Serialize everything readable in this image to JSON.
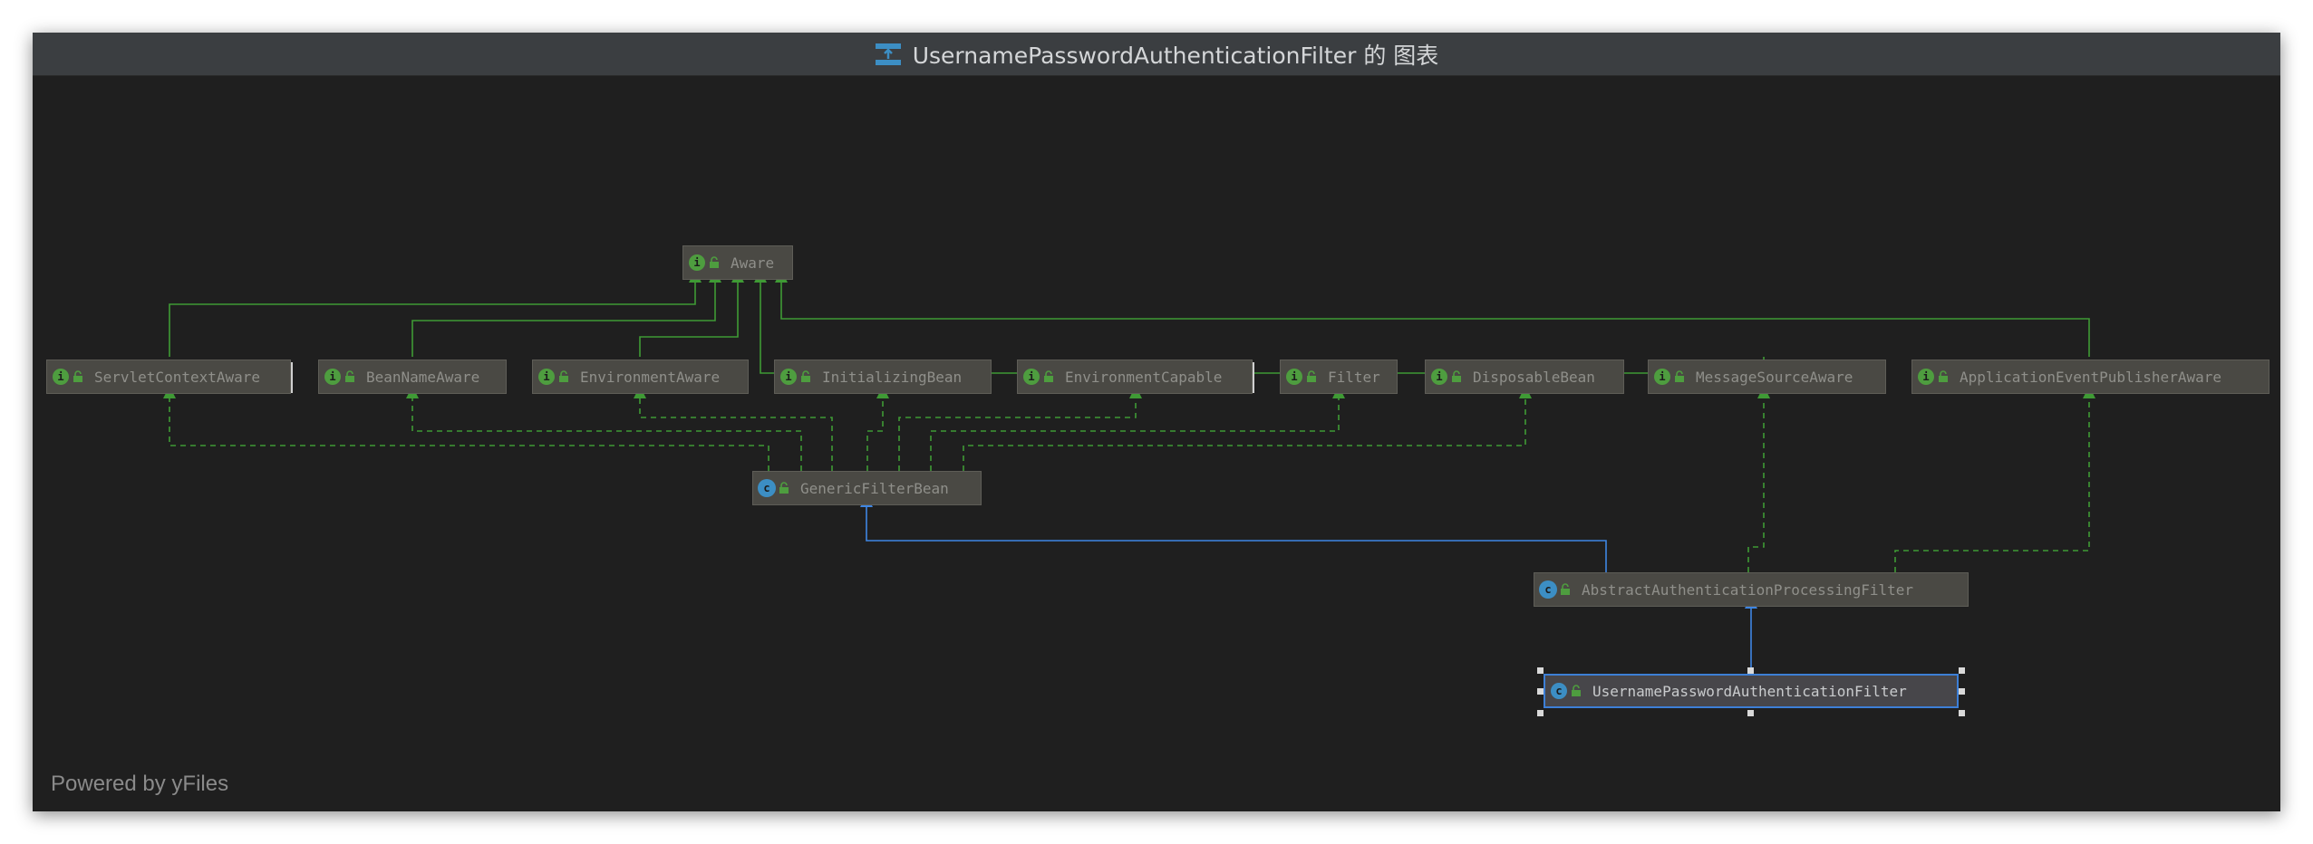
{
  "window": {
    "title": "UsernamePasswordAuthenticationFilter 的 图表",
    "footer": "Powered by yFiles"
  },
  "colors": {
    "background": "#1f1f1f",
    "interface_arrow": "#3f9a35",
    "class_arrow": "#3e86e3",
    "selection": "#3d7fd6"
  },
  "nodes": {
    "aware": {
      "label": "Aware",
      "kind": "interface",
      "badge": "I"
    },
    "servlet_context_aware": {
      "label": "ServletContextAware",
      "kind": "interface",
      "badge": "I"
    },
    "bean_name_aware": {
      "label": "BeanNameAware",
      "kind": "interface",
      "badge": "I"
    },
    "environment_aware": {
      "label": "EnvironmentAware",
      "kind": "interface",
      "badge": "I"
    },
    "initializing_bean": {
      "label": "InitializingBean",
      "kind": "interface",
      "badge": "I"
    },
    "environment_capable": {
      "label": "EnvironmentCapable",
      "kind": "interface",
      "badge": "I"
    },
    "filter": {
      "label": "Filter",
      "kind": "interface",
      "badge": "I"
    },
    "disposable_bean": {
      "label": "DisposableBean",
      "kind": "interface",
      "badge": "I"
    },
    "message_source_aware": {
      "label": "MessageSourceAware",
      "kind": "interface",
      "badge": "I"
    },
    "application_event_publisher_aware": {
      "label": "ApplicationEventPublisherAware",
      "kind": "interface",
      "badge": "I"
    },
    "generic_filter_bean": {
      "label": "GenericFilterBean",
      "kind": "abstract-class",
      "badge": "C"
    },
    "abstract_authentication_processing_filter": {
      "label": "AbstractAuthenticationProcessingFilter",
      "kind": "abstract-class",
      "badge": "C"
    },
    "username_password_authentication_filter": {
      "label": "UsernamePasswordAuthenticationFilter",
      "kind": "class",
      "badge": "C",
      "selected": true
    }
  },
  "edges": [
    {
      "from": "servlet_context_aware",
      "to": "aware",
      "type": "extends"
    },
    {
      "from": "bean_name_aware",
      "to": "aware",
      "type": "extends"
    },
    {
      "from": "environment_aware",
      "to": "aware",
      "type": "extends"
    },
    {
      "from": "message_source_aware",
      "to": "aware",
      "type": "extends"
    },
    {
      "from": "application_event_publisher_aware",
      "to": "aware",
      "type": "extends"
    },
    {
      "from": "generic_filter_bean",
      "to": "servlet_context_aware",
      "type": "implements"
    },
    {
      "from": "generic_filter_bean",
      "to": "bean_name_aware",
      "type": "implements"
    },
    {
      "from": "generic_filter_bean",
      "to": "environment_aware",
      "type": "implements"
    },
    {
      "from": "generic_filter_bean",
      "to": "initializing_bean",
      "type": "implements"
    },
    {
      "from": "generic_filter_bean",
      "to": "environment_capable",
      "type": "implements"
    },
    {
      "from": "generic_filter_bean",
      "to": "filter",
      "type": "implements"
    },
    {
      "from": "generic_filter_bean",
      "to": "disposable_bean",
      "type": "implements"
    },
    {
      "from": "abstract_authentication_processing_filter",
      "to": "generic_filter_bean",
      "type": "extends-class"
    },
    {
      "from": "abstract_authentication_processing_filter",
      "to": "message_source_aware",
      "type": "implements"
    },
    {
      "from": "abstract_authentication_processing_filter",
      "to": "application_event_publisher_aware",
      "type": "implements"
    },
    {
      "from": "username_password_authentication_filter",
      "to": "abstract_authentication_processing_filter",
      "type": "extends-class"
    }
  ]
}
